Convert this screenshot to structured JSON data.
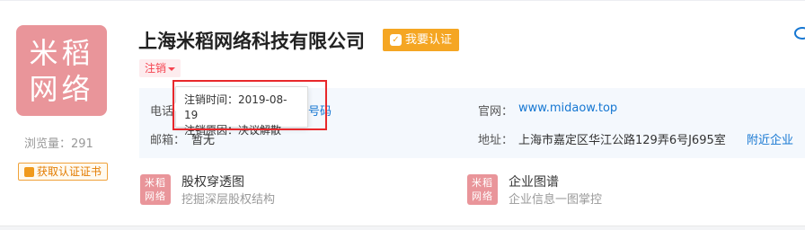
{
  "company": {
    "name": "上海米稻网络科技有限公司",
    "verify_label": "我要认证",
    "status_label": "注销",
    "logo_lines": [
      "米稻",
      "网络"
    ]
  },
  "stats": {
    "views_label": "浏览量：291",
    "cert_label": "获取认证证书"
  },
  "info": {
    "phone_label": "电话",
    "phone_link_fragment": "号码",
    "email_label": "邮箱：",
    "email_value": "暂无",
    "website_label": "官网：",
    "website_value": "www.midaow.top",
    "address_label": "地址：",
    "address_value": "上海市嘉定区华江公路129弄6号J695室",
    "nearby_label": "附近企业"
  },
  "tooltip": {
    "cancel_time": "注销时间：2019-08-19",
    "cancel_reason": "注销原因：决议解散"
  },
  "features": [
    {
      "icon_text": "米稻 网络",
      "title": "股权穿透图",
      "subtitle": "挖掘深层股权结构"
    },
    {
      "icon_text": "米稻 网络",
      "title": "企业图谱",
      "subtitle": "企业信息一图掌控"
    }
  ],
  "colors": {
    "accent": "#1677d2",
    "logo_bg": "#e9959a",
    "verify_bg": "#f5a623",
    "status_red": "#f5424f",
    "highlight": "#e8282b"
  }
}
